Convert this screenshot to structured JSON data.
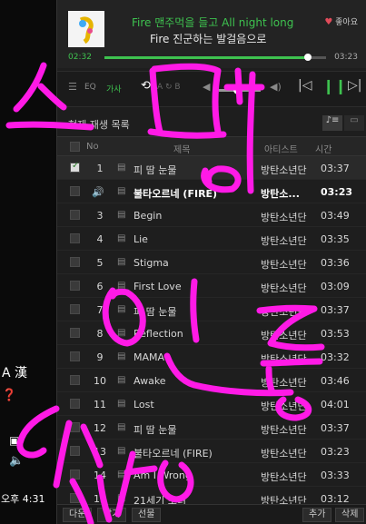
{
  "taskbar": {
    "lang": "A 漢",
    "time": "오후 4:31"
  },
  "now_playing": {
    "lyric_line1": "Fire 맨주먹을 들고 All night long",
    "lyric_line2": "Fire 진군하는 발걸음으로",
    "like_label": "좋아요",
    "time_current": "02:32",
    "time_total": "03:23",
    "progress": 0.92
  },
  "controls": {
    "eq": "EQ",
    "lyrics": "가사",
    "ab": "A ↻ B"
  },
  "playlist": {
    "title": "현재 재생 목록"
  },
  "columns": {
    "no": "No",
    "title": "제목",
    "artist": "아티스트",
    "time": "시간"
  },
  "rows": [
    {
      "no": "1",
      "title": "피 땀 눈물",
      "artist": "방탄소년단",
      "time": "03:37"
    },
    {
      "no": "",
      "title": "불타오르네 (FIRE)",
      "artist": "방탄소...",
      "time": "03:23"
    },
    {
      "no": "3",
      "title": "Begin",
      "artist": "방탄소년단",
      "time": "03:49"
    },
    {
      "no": "4",
      "title": "Lie",
      "artist": "방탄소년단",
      "time": "03:35"
    },
    {
      "no": "5",
      "title": "Stigma",
      "artist": "방탄소년단",
      "time": "03:36"
    },
    {
      "no": "6",
      "title": "First Love",
      "artist": "방탄소년단",
      "time": "03:09"
    },
    {
      "no": "7",
      "title": "피 땀 눈물",
      "artist": "방탄소년단",
      "time": "03:37"
    },
    {
      "no": "8",
      "title": "Reflection",
      "artist": "방탄소년단",
      "time": "03:53"
    },
    {
      "no": "9",
      "title": "MAMA",
      "artist": "방탄소년단",
      "time": "03:32"
    },
    {
      "no": "10",
      "title": "Awake",
      "artist": "방탄소년단",
      "time": "03:46"
    },
    {
      "no": "11",
      "title": "Lost",
      "artist": "방탄소년단",
      "time": "04:01"
    },
    {
      "no": "12",
      "title": "피 땀 눈물",
      "artist": "방탄소년단",
      "time": "03:37"
    },
    {
      "no": "13",
      "title": "불타오르네 (FIRE)",
      "artist": "방탄소년단",
      "time": "03:23"
    },
    {
      "no": "14",
      "title": "Am I Wrong",
      "artist": "방탄소년단",
      "time": "03:33"
    },
    {
      "no": "15",
      "title": "21세기 소녀",
      "artist": "방탄소년단",
      "time": "03:12"
    }
  ],
  "bottom": {
    "download": "다운",
    "keep": "담기",
    "gift": "선물",
    "add": "추가",
    "delete": "삭제"
  },
  "colors": {
    "accent": "#3ec24f",
    "scribble": "#ff1ae6"
  }
}
